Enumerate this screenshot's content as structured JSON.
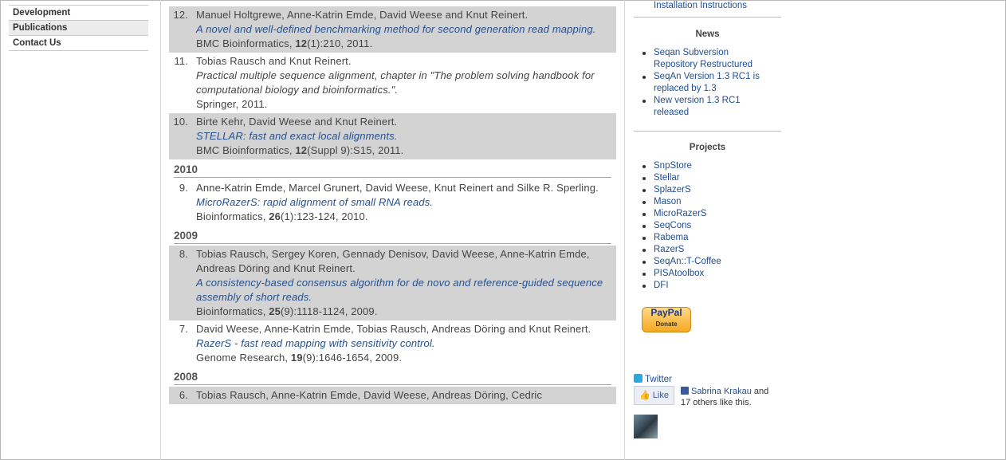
{
  "nav": {
    "items": [
      "Development",
      "Publications",
      "Contact Us"
    ]
  },
  "publications": {
    "entries": [
      {
        "num": "12.",
        "authors": "Manuel Holtgrewe, Anne-Katrin Emde, David Weese and Knut Reinert.",
        "title": "A novel and well-defined benchmarking method for second generation read mapping.",
        "venue": "BMC Bioinformatics, ",
        "volume": "12",
        "rest": "(1):210, 2011."
      },
      {
        "num": "11.",
        "authors": "Tobias Rausch and Knut Reinert.",
        "title": "Practical multiple sequence alignment, chapter in \"The problem solving handbook for computational biology and bioinformatics.\".",
        "venue": "Springer, 2011.",
        "volume": "",
        "rest": ""
      },
      {
        "num": "10.",
        "authors": "Birte Kehr, David Weese and Knut Reinert.",
        "title": "STELLAR: fast and exact local alignments.",
        "venue": "BMC Bioinformatics, ",
        "volume": "12",
        "rest": "(Suppl 9):S15, 2011."
      },
      {
        "num": "9.",
        "authors": "Anne-Katrin Emde, Marcel Grunert, David Weese, Knut Reinert and Silke R. Sperling.",
        "title": "MicroRazerS: rapid alignment of small RNA reads.",
        "venue": "Bioinformatics, ",
        "volume": "26",
        "rest": "(1):123-124, 2010."
      },
      {
        "num": "8.",
        "authors": "Tobias Rausch, Sergey Koren, Gennady Denisov, David Weese, Anne-Katrin Emde, Andreas Döring and Knut Reinert.",
        "title": "A consistency-based consensus algorithm for de novo and reference-guided sequence assembly of short reads.",
        "venue": "Bioinformatics, ",
        "volume": "25",
        "rest": "(9):1118-1124, 2009."
      },
      {
        "num": "7.",
        "authors": "David Weese, Anne-Katrin Emde, Tobias Rausch, Andreas Döring and Knut Reinert.",
        "title": "RazerS - fast read mapping with sensitivity control.",
        "venue": "Genome Research, ",
        "volume": "19",
        "rest": "(9):1646-1654, 2009."
      },
      {
        "num": "6.",
        "authors": "Tobias Rausch, Anne-Katrin Emde, David Weese, Andreas Döring, Cedric"
      }
    ],
    "years": [
      "2010",
      "2009",
      "2008"
    ]
  },
  "sidebar": {
    "install_link": "Installation Instructions",
    "news_heading": "News",
    "news": [
      "Seqan Subversion Repository Restructured",
      "SeqAn Version 1.3 RC1 is replaced by 1.3",
      "New version 1.3 RC1 released"
    ],
    "projects_heading": "Projects",
    "projects": [
      "SnpStore",
      "Stellar",
      "SplazerS",
      "Mason",
      "MicroRazerS",
      "SeqCons",
      "Rabema",
      "RazerS",
      "SeqAn::T-Coffee",
      "PISAtoolbox",
      "DFI"
    ],
    "paypal_label": "PayPal",
    "paypal_sub": "Donate",
    "twitter_label": "Twitter",
    "like_label": "Like",
    "fb_name": "Sabrina Krakau",
    "fb_rest": " and 17 others like this.",
    "icons": [
      "twitter-icon",
      "thumb-up-icon",
      "facebook-icon"
    ]
  }
}
